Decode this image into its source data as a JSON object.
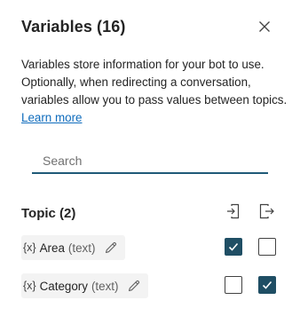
{
  "panel": {
    "title": "Variables (16)",
    "close_icon": "close-icon",
    "description": "Variables store information for your bot to use. Optionally, when redirecting a conversation, variables allow you to pass values between topics.",
    "learn_more_label": "Learn more"
  },
  "search": {
    "placeholder": "Search",
    "value": ""
  },
  "section": {
    "title": "Topic (2)",
    "receive_icon": "receive-from-topic-icon",
    "return_icon": "return-to-topic-icon"
  },
  "variables": [
    {
      "tag": "{x}",
      "name": "Area",
      "type": "(text)",
      "edit_icon": "pencil-icon",
      "receive_checked": true,
      "return_checked": false
    },
    {
      "tag": "{x}",
      "name": "Category",
      "type": "(text)",
      "edit_icon": "pencil-icon",
      "receive_checked": false,
      "return_checked": true
    }
  ],
  "colors": {
    "accent": "#1f4e64",
    "link": "#0f6cbd",
    "chip_bg": "#f3f3f3"
  }
}
